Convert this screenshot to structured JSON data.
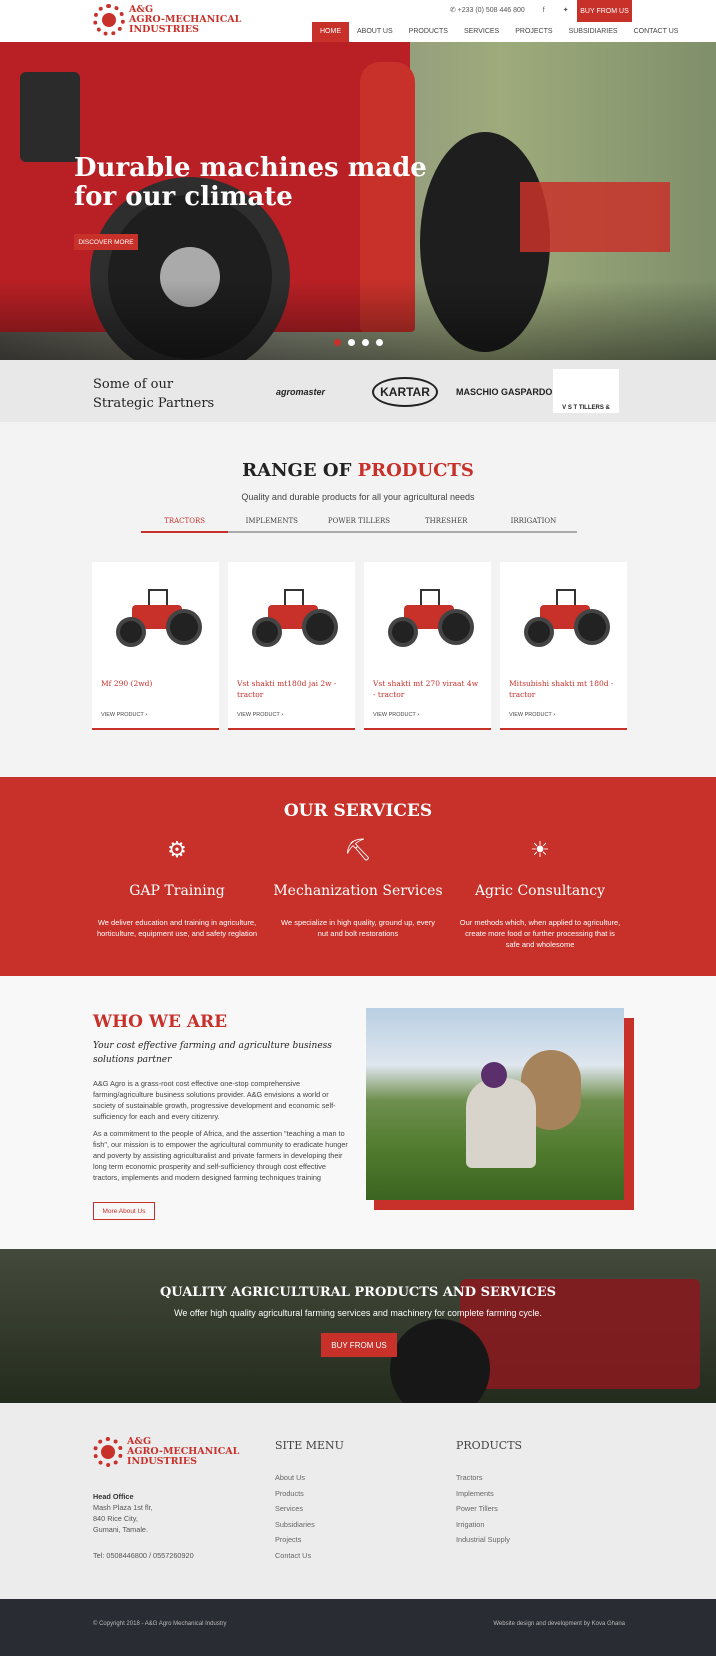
{
  "brand": {
    "line1": "A&G",
    "line2": "AGRO-MECHANICAL",
    "line3": "INDUSTRIES"
  },
  "topbar": {
    "phone": "+233 (0) 508 446 800",
    "facebook_icon": "facebook-icon",
    "twitter_icon": "twitter-icon",
    "youtube_icon": "youtube-icon",
    "buy_label": "BUY FROM US"
  },
  "nav": {
    "items": [
      "HOME",
      "ABOUT US",
      "PRODUCTS",
      "SERVICES",
      "PROJECTS",
      "SUBSIDIARIES",
      "CONTACT US"
    ],
    "active": "HOME"
  },
  "hero": {
    "title": "Durable machines made for our climate",
    "button": "DISCOVER MORE"
  },
  "partners": {
    "title_line1": "Some of our",
    "title_line2": "Strategic Partners",
    "logos": [
      "agromaster",
      "KARTAR",
      "MASCHIO GASPARDO",
      "V S T TILLERS &"
    ]
  },
  "products": {
    "title_a": "RANGE OF ",
    "title_b": "PRODUCTS",
    "subtitle": "Quality and durable products for all your agricultural needs",
    "tabs": [
      "TRACTORS",
      "IMPLEMENTS",
      "POWER TILLERS",
      "THRESHER",
      "IRRIGATION"
    ],
    "active_tab": "TRACTORS",
    "items": [
      {
        "name": "Mf 290 (2wd)",
        "link": "VIEW PRODUCT ›"
      },
      {
        "name": "Vst shakti mt180d jai 2w - tractor",
        "link": "VIEW PRODUCT ›"
      },
      {
        "name": "Vst shakti mt 270 viraat 4w - tractor",
        "link": "VIEW PRODUCT ›"
      },
      {
        "name": "Mitsubishi shakti mt 180d - tractor",
        "link": "VIEW PRODUCT ›"
      }
    ]
  },
  "services": {
    "title": "OUR SERVICES",
    "items": [
      {
        "icon": "tractor-icon",
        "title": "GAP Training",
        "desc": "We deliver education and training in agriculture, horticulture, equipment use, and safety reglation"
      },
      {
        "icon": "wheelbarrow-icon",
        "title": "Mechanization Services",
        "desc": "We specialize in high quality, ground up, every nut and bolt restorations"
      },
      {
        "icon": "onion-icon",
        "title": "Agric Consultancy",
        "desc": "Our methods which, when applied to agriculture, create more food or further processing that is safe and wholesome"
      }
    ]
  },
  "who": {
    "title": "WHO WE ARE",
    "lead": "Your cost effective farming and agriculture business solutions partner",
    "p1": "A&G Agro is a grass-root cost effective one-stop comprehensive farming/agriculture business solutions provider. A&G envisions a world or society of sustainable growth, progressive development and economic self-sufficiency for each and every citizenry.",
    "p2": "As a commitment to the people of Africa, and the assertion \"teaching a man to fish\", our mission is to empower the agricultural community to eradicate hunger and poverty by assisting agriculturalist and private farmers in developing their long term economic prosperity and self-sufficiency through cost effective tractors, implements and modern designed farming techniques training",
    "button": "More About Us"
  },
  "quality": {
    "title": "QUALITY AGRICULTURAL PRODUCTS AND SERVICES",
    "subtitle": "We offer high quality agricultural farming services and machinery for complete farming cycle.",
    "button": "BUY FROM US"
  },
  "footer": {
    "office_heading": "Head Office",
    "address": [
      "Mash Plaza 1st flr,",
      "840 Rice City,",
      "Gumani, Tamale."
    ],
    "tel": "Tel: 0508446800 / 0557260920",
    "menu_title": "SITE MENU",
    "menu": [
      "About Us",
      "Products",
      "Services",
      "Subsidiaries",
      "Projects",
      "Contact Us"
    ],
    "products_title": "PRODUCTS",
    "products": [
      "Tractors",
      "Implements",
      "Power Tillers",
      "Irrigation",
      "Industrial Supply"
    ],
    "copyright": "© Copyright 2018 - A&G Agro Mechanical Industry",
    "credit": "Website design and development by Kova Ghana"
  },
  "colors": {
    "brand_red": "#c8312a",
    "dark_footer": "#2a2c33"
  }
}
